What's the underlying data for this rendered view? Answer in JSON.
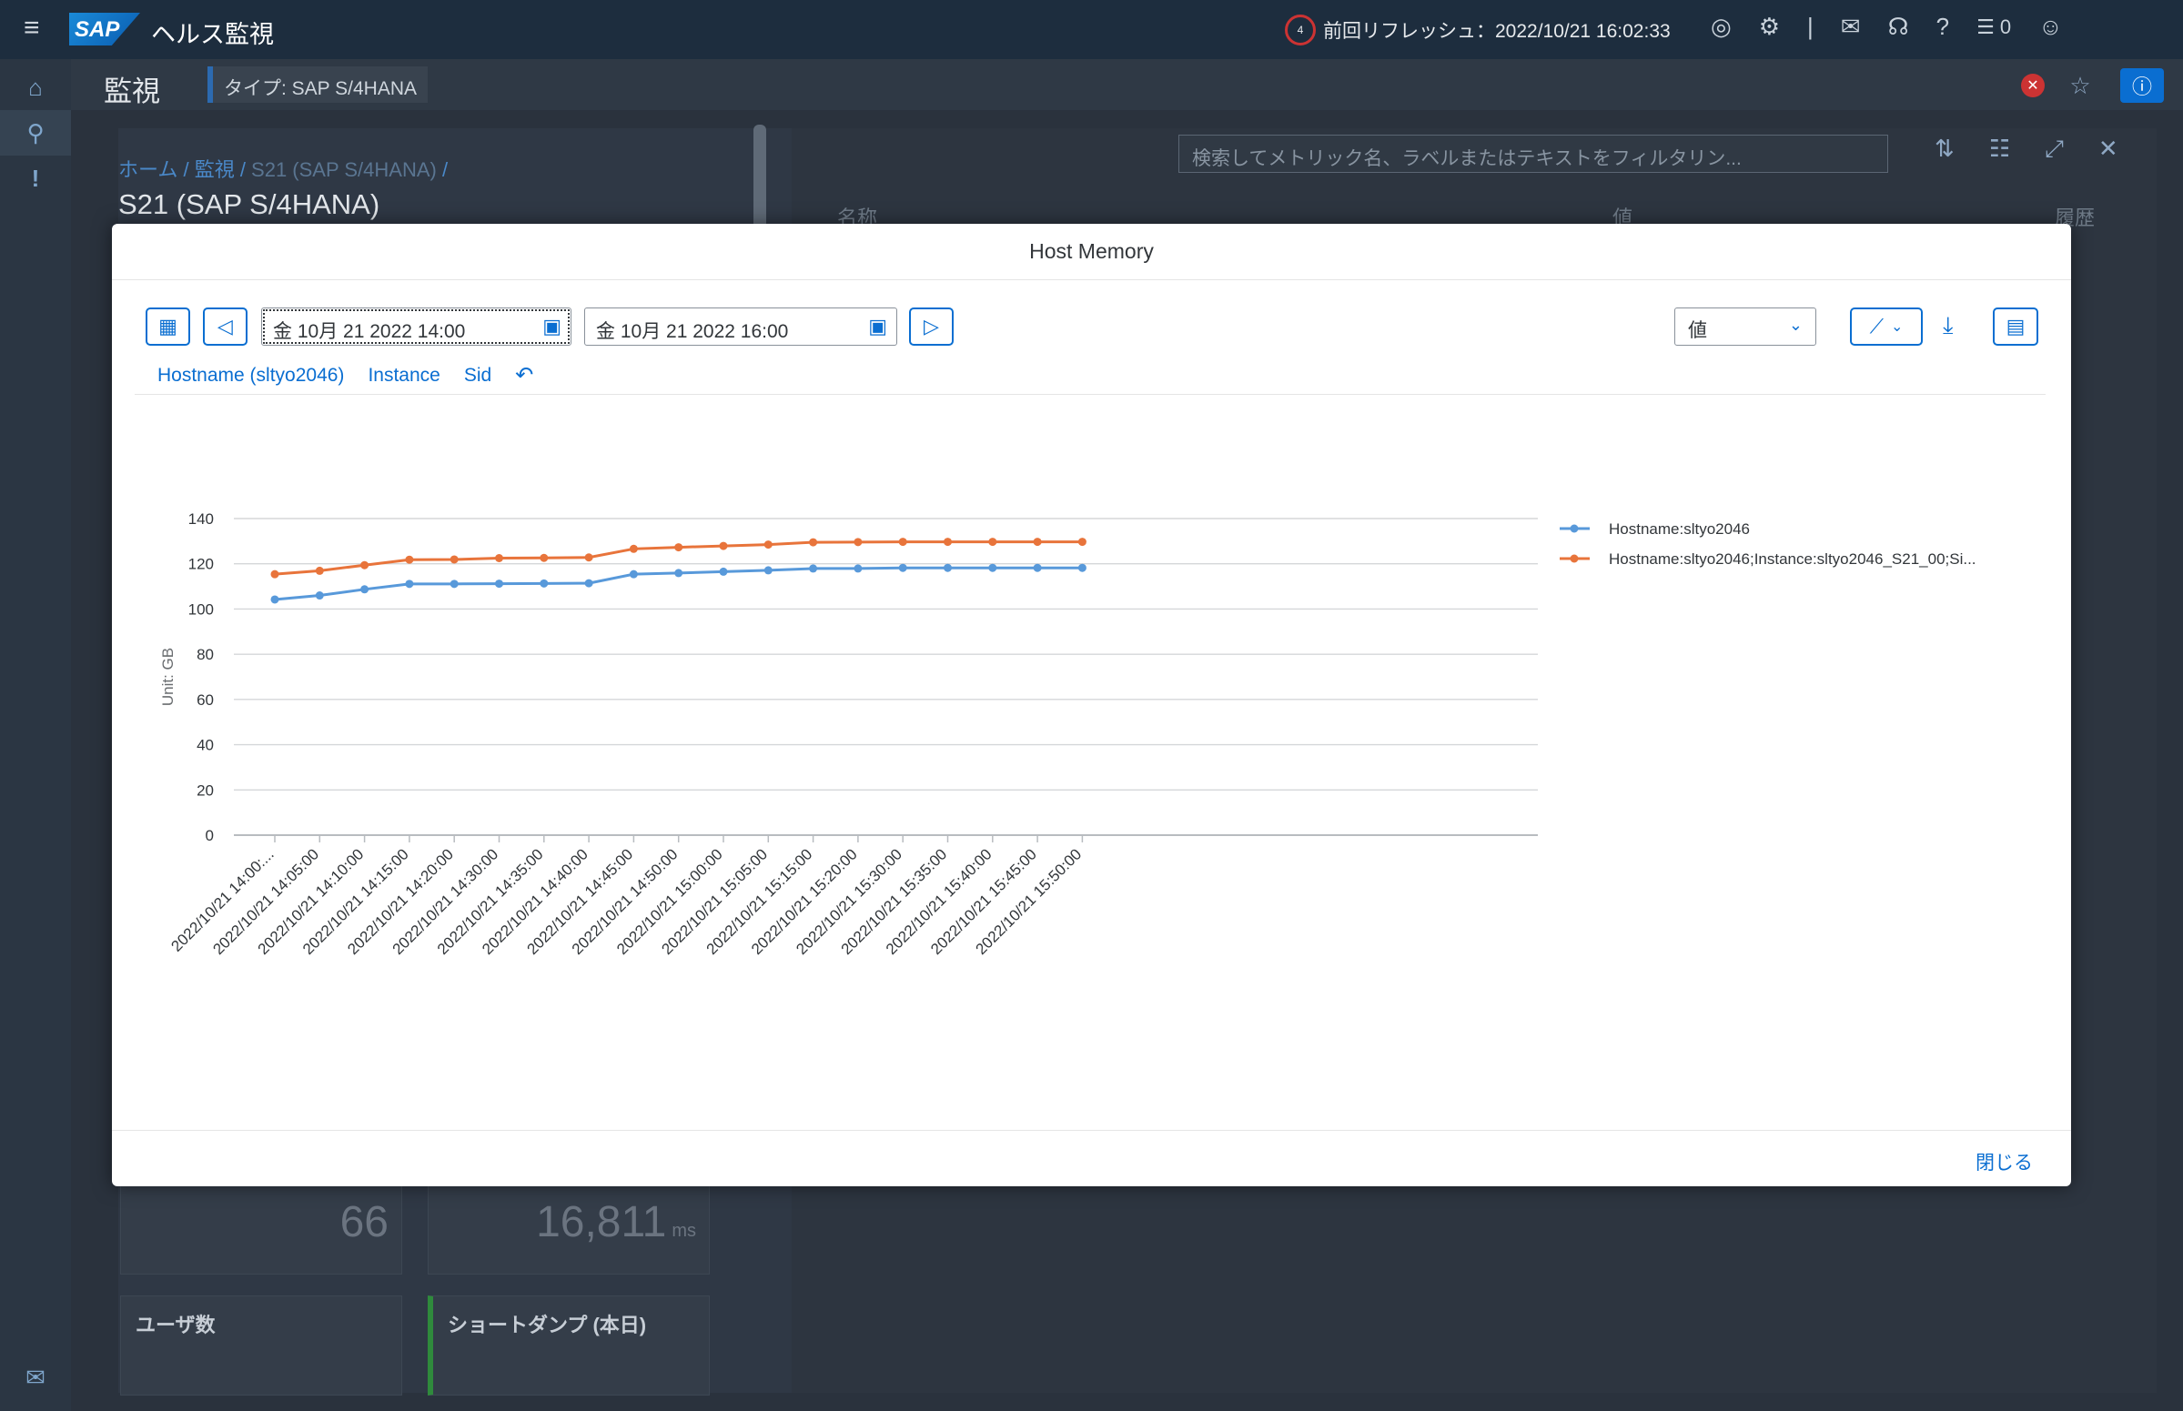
{
  "shell": {
    "app_title": "ヘルス監視",
    "logo_text": "SAP",
    "last_refresh": "前回リフレッシュ：2022/10/21 16:02:33",
    "notifications_count": "0"
  },
  "page": {
    "title": "監視",
    "type_label": "タイプ: SAP S/4HANA"
  },
  "background": {
    "breadcrumb": [
      "ホーム",
      "監視",
      "S21 (SAP S/4HANA)"
    ],
    "system_title": "S21 (SAP S/4HANA)",
    "search_placeholder": "検索してメトリック名、ラベルまたはテキストをフィルタリン...",
    "columns": [
      "名称",
      "値",
      "履歴"
    ],
    "tiles": [
      {
        "value": "66",
        "unit": ""
      },
      {
        "value": "16,811",
        "unit": "ms"
      }
    ],
    "tile_labels": [
      "ユーザ数",
      "ショートダンプ (本日)"
    ]
  },
  "dialog": {
    "title": "Host Memory",
    "start_date": "金 10月 21 2022 14:00",
    "end_date": "金 10月 21 2022 16:00",
    "value_select": "値",
    "filters": [
      "Hostname (sltyo2046)",
      "Instance",
      "Sid"
    ],
    "close_label": "閉じる"
  },
  "chart_data": {
    "type": "line",
    "ylabel": "Unit: GB",
    "ylim": [
      0,
      140
    ],
    "yticks": [
      0,
      20,
      40,
      60,
      80,
      100,
      120,
      140
    ],
    "grid": true,
    "legend_position": "top-right",
    "categories": [
      "2022/10/21 14:00:...",
      "2022/10/21 14:05:00",
      "2022/10/21 14:10:00",
      "2022/10/21 14:15:00",
      "2022/10/21 14:20:00",
      "2022/10/21 14:30:00",
      "2022/10/21 14:35:00",
      "2022/10/21 14:40:00",
      "2022/10/21 14:45:00",
      "2022/10/21 14:50:00",
      "2022/10/21 15:00:00",
      "2022/10/21 15:05:00",
      "2022/10/21 15:15:00",
      "2022/10/21 15:20:00",
      "2022/10/21 15:30:00",
      "2022/10/21 15:35:00",
      "2022/10/21 15:40:00",
      "2022/10/21 15:45:00",
      "2022/10/21 15:50:00"
    ],
    "series": [
      {
        "name": "Hostname:sltyo2046",
        "color": "#5899da",
        "values": [
          104.2,
          106.0,
          108.7,
          111.1,
          111.1,
          111.2,
          111.3,
          111.4,
          115.4,
          115.9,
          116.5,
          117.1,
          117.9,
          117.9,
          118.2,
          118.2,
          118.2,
          118.2,
          118.2
        ]
      },
      {
        "name": "Hostname:sltyo2046;Instance:sltyo2046_S21_00;Si...",
        "color": "#e8743b",
        "values": [
          115.4,
          116.9,
          119.4,
          121.8,
          121.9,
          122.5,
          122.6,
          122.8,
          126.6,
          127.3,
          127.9,
          128.5,
          129.5,
          129.6,
          129.7,
          129.7,
          129.7,
          129.7,
          129.7
        ]
      }
    ]
  }
}
